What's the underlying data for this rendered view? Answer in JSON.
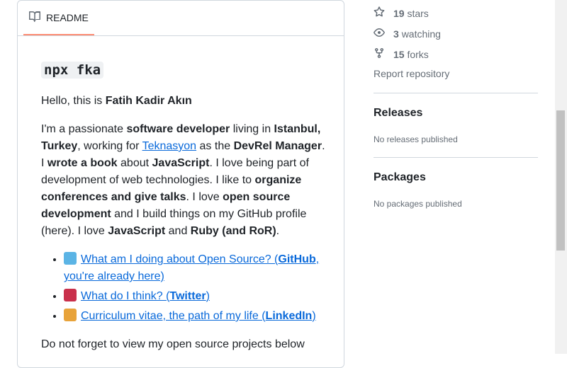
{
  "readme": {
    "tab_label": "README",
    "heading_code": "npx fka",
    "hello": {
      "prefix": "Hello, this is ",
      "name": "Fatih Kadir Akın"
    },
    "bio": [
      {
        "t": "I'm a passionate "
      },
      {
        "b": "software developer"
      },
      {
        "t": " living in "
      },
      {
        "b": "Istanbul, Turkey"
      },
      {
        "t": ", working for "
      },
      {
        "a": "Teknasyon"
      },
      {
        "t": " as the "
      },
      {
        "b": "DevRel Manager"
      },
      {
        "t": ". I "
      },
      {
        "b": "wrote a book"
      },
      {
        "t": " about "
      },
      {
        "b": "JavaScript"
      },
      {
        "t": ". I love being part of development of web technologies. I like to "
      },
      {
        "b": "organize conferences and give talks"
      },
      {
        "t": ". I love "
      },
      {
        "b": "open source development"
      },
      {
        "t": " and I build things on my GitHub profile (here). I love "
      },
      {
        "b": "JavaScript"
      },
      {
        "t": " and "
      },
      {
        "b": "Ruby (and RoR)"
      },
      {
        "t": "."
      }
    ],
    "links": [
      {
        "emoji": "laptop",
        "color": "#5bb4e5",
        "pre": "What am I doing about Open Source? (",
        "bold": "GitHub",
        "post": ", you're already here)"
      },
      {
        "emoji": "boot",
        "color": "#c9304b",
        "pre": "What do I think? (",
        "bold": "Twitter",
        "post": ")"
      },
      {
        "emoji": "plane",
        "color": "#e8a33a",
        "pre": "Curriculum vitae, the path of my life (",
        "bold": "LinkedIn",
        "post": ")"
      }
    ],
    "footer_text": "Do not forget to view my open source projects below"
  },
  "sidebar": {
    "stars": {
      "count": "19",
      "label": "stars"
    },
    "watching": {
      "count": "3",
      "label": "watching"
    },
    "forks": {
      "count": "15",
      "label": "forks"
    },
    "report": "Report repository",
    "releases": {
      "title": "Releases",
      "note": "No releases published"
    },
    "packages": {
      "title": "Packages",
      "note": "No packages published"
    }
  },
  "colors": {
    "link": "#0969da",
    "accent_tab": "#fd8c73",
    "border": "#d0d7de",
    "muted": "#656d76"
  }
}
